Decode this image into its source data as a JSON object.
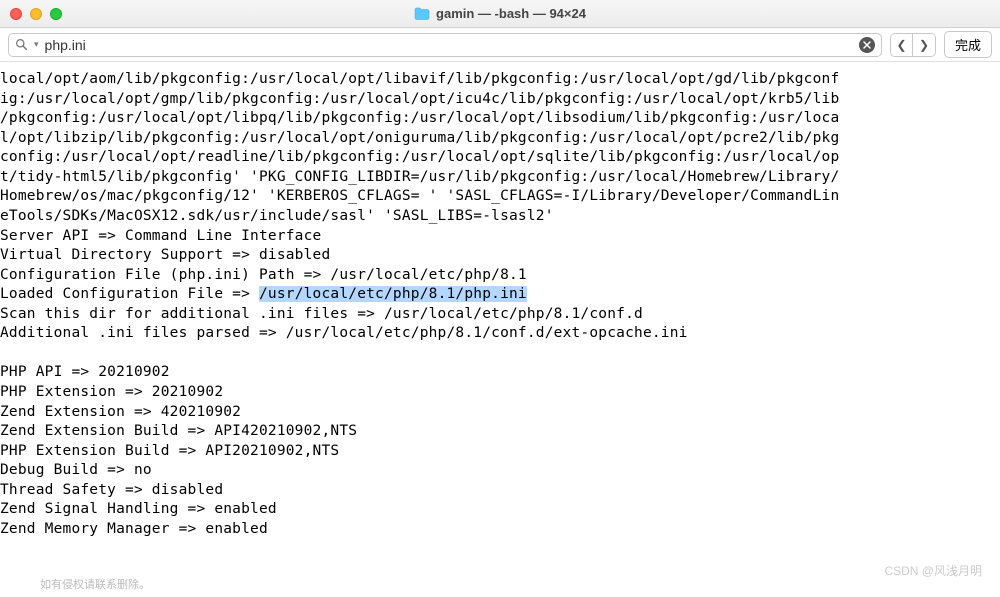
{
  "window": {
    "title": "gamin — -bash — 94×24"
  },
  "search": {
    "value": "php.ini",
    "done_label": "完成"
  },
  "terminal": {
    "line1": "local/opt/aom/lib/pkgconfig:/usr/local/opt/libavif/lib/pkgconfig:/usr/local/opt/gd/lib/pkgconf",
    "line2": "ig:/usr/local/opt/gmp/lib/pkgconfig:/usr/local/opt/icu4c/lib/pkgconfig:/usr/local/opt/krb5/lib",
    "line3": "/pkgconfig:/usr/local/opt/libpq/lib/pkgconfig:/usr/local/opt/libsodium/lib/pkgconfig:/usr/loca",
    "line4": "l/opt/libzip/lib/pkgconfig:/usr/local/opt/oniguruma/lib/pkgconfig:/usr/local/opt/pcre2/lib/pkg",
    "line5": "config:/usr/local/opt/readline/lib/pkgconfig:/usr/local/opt/sqlite/lib/pkgconfig:/usr/local/op",
    "line6": "t/tidy-html5/lib/pkgconfig' 'PKG_CONFIG_LIBDIR=/usr/lib/pkgconfig:/usr/local/Homebrew/Library/",
    "line7": "Homebrew/os/mac/pkgconfig/12' 'KERBEROS_CFLAGS= ' 'SASL_CFLAGS=-I/Library/Developer/CommandLin",
    "line8": "eTools/SDKs/MacOSX12.sdk/usr/include/sasl' 'SASL_LIBS=-lsasl2'",
    "line9": "Server API => Command Line Interface",
    "line10": "Virtual Directory Support => disabled",
    "line11": "Configuration File (php.ini) Path => /usr/local/etc/php/8.1",
    "line12_pre": "Loaded Configuration File => ",
    "line12_hl": "/usr/local/etc/php/8.1/php.ini",
    "line13": "Scan this dir for additional .ini files => /usr/local/etc/php/8.1/conf.d",
    "line14": "Additional .ini files parsed => /usr/local/etc/php/8.1/conf.d/ext-opcache.ini",
    "line15": "",
    "line16": "PHP API => 20210902",
    "line17": "PHP Extension => 20210902",
    "line18": "Zend Extension => 420210902",
    "line19": "Zend Extension Build => API420210902,NTS",
    "line20": "PHP Extension Build => API20210902,NTS",
    "line21": "Debug Build => no",
    "line22": "Thread Safety => disabled",
    "line23": "Zend Signal Handling => enabled",
    "line24": "Zend Memory Manager => enabled"
  },
  "watermark": {
    "left": "如有侵权请联系删除。",
    "right": "CSDN @风浅月明"
  }
}
